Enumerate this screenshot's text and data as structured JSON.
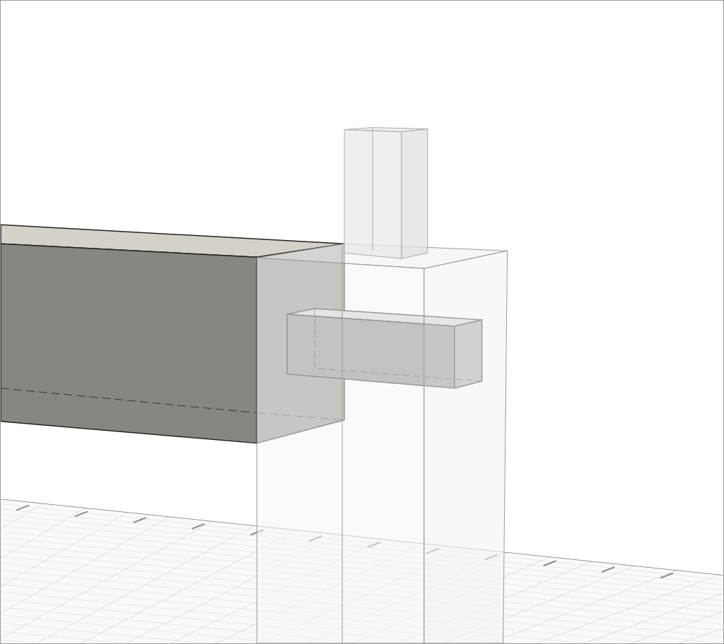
{
  "viewport": {
    "objects": [
      {
        "kind": "grid"
      },
      {
        "kind": "beam"
      },
      {
        "kind": "tenon"
      },
      {
        "kind": "post"
      },
      {
        "kind": "peg"
      }
    ]
  }
}
